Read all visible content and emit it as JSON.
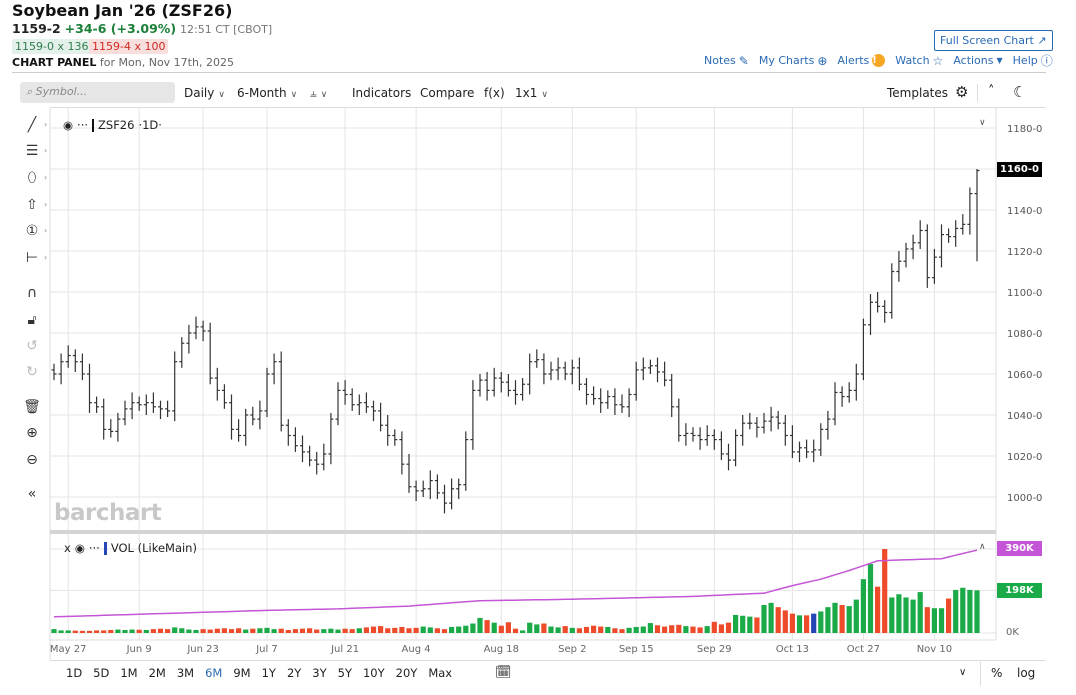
{
  "header": {
    "title": "Soybean Jan '26 (ZSF26)",
    "last": "1159-2",
    "change": "+34-6 (+3.09%)",
    "time": "12:51 CT [CBOT]",
    "bid": "1159-0 x 136",
    "ask": "1159-4 x 100",
    "panel_label": "CHART PANEL",
    "panel_date": "for Mon, Nov 17th, 2025",
    "fullscreen": "Full Screen Chart"
  },
  "links": {
    "notes": "Notes",
    "mycharts": "My Charts",
    "alerts": "Alerts",
    "watch": "Watch",
    "actions": "Actions",
    "help": "Help"
  },
  "toolbar": {
    "search_placeholder": "Symbol...",
    "interval": "Daily",
    "range": "6-Month",
    "indicators": "Indicators",
    "compare": "Compare",
    "fx": "f(x)",
    "layout": "1x1",
    "templates": "Templates"
  },
  "legend": {
    "symbol": "ZSF26",
    "period": "·1D·",
    "dots": "···",
    "vol": "VOL (LikeMain)",
    "close": "x"
  },
  "watermark": "barchart",
  "colors": {
    "up": "#1aaa47",
    "down": "#ee4b2b",
    "special": "#2447b5",
    "avg": "#c455d6",
    "last_tag": "#000000",
    "vol_avg_tag": "#c455d6",
    "vol_tag": "#1aaa47"
  },
  "chart_data": {
    "type": "ohlc",
    "symbol": "ZSF26",
    "ylim": [
      985,
      1188
    ],
    "y_ticks": [
      "1000-0",
      "1020-0",
      "1040-0",
      "1060-0",
      "1080-0",
      "1100-0",
      "1120-0",
      "1140-0",
      "1160-0",
      "1180-0"
    ],
    "y_tick_values": [
      1000,
      1020,
      1040,
      1060,
      1080,
      1100,
      1120,
      1140,
      1160,
      1180
    ],
    "last_label": "1160-0",
    "last_bar": {
      "high": 1160,
      "low": 1115
    },
    "close": [
      1060,
      1066,
      1069,
      1066,
      1060,
      1046,
      1044,
      1033,
      1032,
      1038,
      1043,
      1046,
      1045,
      1046,
      1044,
      1043,
      1042,
      1066,
      1075,
      1080,
      1083,
      1081,
      1058,
      1052,
      1046,
      1033,
      1030,
      1040,
      1038,
      1042,
      1060,
      1066,
      1035,
      1030,
      1025,
      1022,
      1018,
      1016,
      1021,
      1038,
      1052,
      1050,
      1045,
      1046,
      1044,
      1042,
      1035,
      1030,
      1028,
      1016,
      1005,
      1003,
      1004,
      1008,
      1002,
      997,
      1004,
      1006,
      1028,
      1052,
      1057,
      1052,
      1058,
      1056,
      1052,
      1050,
      1055,
      1066,
      1067,
      1060,
      1062,
      1063,
      1060,
      1063,
      1055,
      1050,
      1048,
      1046,
      1049,
      1045,
      1044,
      1050,
      1062,
      1063,
      1064,
      1061,
      1057,
      1044,
      1030,
      1031,
      1030,
      1028,
      1030,
      1028,
      1021,
      1018,
      1030,
      1036,
      1036,
      1034,
      1037,
      1039,
      1036,
      1030,
      1022,
      1024,
      1022,
      1023,
      1033,
      1038,
      1051,
      1049,
      1052,
      1060,
      1084,
      1095,
      1093,
      1090,
      1110,
      1115,
      1121,
      1124,
      1130,
      1107,
      1117,
      1128,
      1127,
      1131,
      1133,
      1148,
      1159.25
    ],
    "x_labels": [
      {
        "label": "May 27",
        "index": 2
      },
      {
        "label": "Jun 9",
        "index": 12
      },
      {
        "label": "Jun 23",
        "index": 21
      },
      {
        "label": "Jul 7",
        "index": 30
      },
      {
        "label": "Jul 21",
        "index": 41
      },
      {
        "label": "Aug 4",
        "index": 51
      },
      {
        "label": "Aug 18",
        "index": 63
      },
      {
        "label": "Sep 2",
        "index": 73
      },
      {
        "label": "Sep 15",
        "index": 82
      },
      {
        "label": "Sep 29",
        "index": 93
      },
      {
        "label": "Oct 13",
        "index": 104
      },
      {
        "label": "Oct 27",
        "index": 114
      },
      {
        "label": "Nov 10",
        "index": 124
      }
    ],
    "volume_k": [
      18,
      12,
      12,
      11,
      10,
      10,
      12,
      12,
      14,
      16,
      14,
      16,
      15,
      14,
      18,
      20,
      18,
      26,
      22,
      16,
      14,
      18,
      16,
      20,
      22,
      18,
      22,
      16,
      20,
      22,
      24,
      18,
      20,
      14,
      18,
      20,
      22,
      16,
      18,
      20,
      16,
      20,
      18,
      22,
      26,
      30,
      32,
      22,
      24,
      28,
      22,
      24,
      30,
      26,
      22,
      18,
      28,
      30,
      34,
      44,
      70,
      60,
      48,
      34,
      50,
      20,
      12,
      48,
      40,
      44,
      30,
      26,
      32,
      24,
      22,
      28,
      34,
      30,
      28,
      22,
      18,
      24,
      28,
      30,
      46,
      36,
      30,
      36,
      38,
      32,
      30,
      26,
      32,
      52,
      40,
      48,
      84,
      80,
      76,
      72,
      130,
      140,
      120,
      105,
      90,
      82,
      82,
      90,
      100,
      120,
      140,
      130,
      125,
      155,
      250,
      320,
      215,
      390,
      165,
      180,
      165,
      155,
      190,
      120,
      115,
      115,
      160,
      200,
      210,
      200,
      198
    ],
    "special_volume_index": 107,
    "vol_avg_points": [
      [
        0,
        75
      ],
      [
        10,
        85
      ],
      [
        20,
        95
      ],
      [
        30,
        105
      ],
      [
        40,
        112
      ],
      [
        50,
        125
      ],
      [
        58,
        145
      ],
      [
        60,
        150
      ],
      [
        70,
        155
      ],
      [
        80,
        162
      ],
      [
        90,
        170
      ],
      [
        100,
        185
      ],
      [
        104,
        220
      ],
      [
        108,
        250
      ],
      [
        112,
        290
      ],
      [
        116,
        335
      ],
      [
        120,
        340
      ],
      [
        125,
        345
      ],
      [
        130,
        385
      ]
    ],
    "vol_ylim": [
      0,
      390
    ],
    "vol_tags": {
      "avg": "390K",
      "vol": "198K",
      "zero": "0K"
    }
  },
  "ranges": [
    {
      "label": "1D"
    },
    {
      "label": "5D"
    },
    {
      "label": "1M"
    },
    {
      "label": "2M"
    },
    {
      "label": "3M"
    },
    {
      "label": "6M",
      "active": true
    },
    {
      "label": "9M"
    },
    {
      "label": "1Y"
    },
    {
      "label": "2Y"
    },
    {
      "label": "3Y"
    },
    {
      "label": "5Y"
    },
    {
      "label": "10Y"
    },
    {
      "label": "20Y"
    },
    {
      "label": "Max"
    }
  ],
  "bottom": {
    "percent": "%",
    "log": "log"
  }
}
